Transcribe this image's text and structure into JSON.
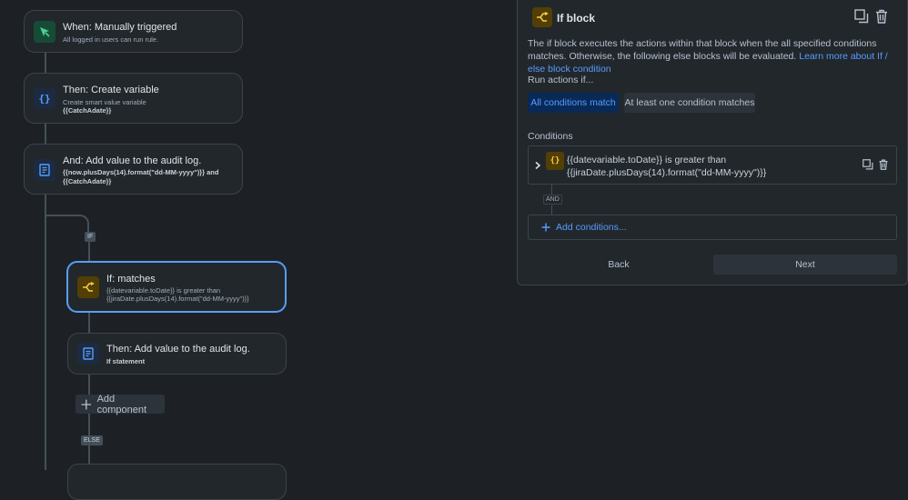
{
  "colors": {
    "background": "#1d2125",
    "card": "#22272b",
    "accent": "#579dff",
    "trigger_green": "#4bce97",
    "branch_yellow": "#f5cd47"
  },
  "flow": {
    "trigger": {
      "title": "When: Manually triggered",
      "subtitle": "All logged in users can run rule.",
      "icon": "cursor-click-icon"
    },
    "create_variable": {
      "title": "Then: Create variable",
      "subtitle": "Create smart value variable",
      "detail": "{{CatchAdate}}",
      "icon": "braces-icon"
    },
    "audit_log_1": {
      "title": "And: Add value to the audit log.",
      "detail_line1": "{{now.plusDays(14).format(\"dd-MM-yyyy\")}} and",
      "detail_line2": "{{CatchAdate}}",
      "icon": "document-icon"
    },
    "if_pill": "IF",
    "if_matches": {
      "title": "If: matches",
      "line1": "{{datevariable.toDate}} is greater than",
      "line2": "{{jiraDate.plusDays(14).format(\"dd-MM-yyyy\")}}",
      "icon": "branch-icon"
    },
    "audit_log_2": {
      "title": "Then: Add value to the audit log.",
      "detail": "If statement",
      "icon": "document-icon"
    },
    "add_component": "Add component",
    "else_pill": "ELSE"
  },
  "panel": {
    "title": "If block",
    "description": "The if block executes the actions within that block when the all specified conditions matches. Otherwise, the following else blocks will be evaluated. ",
    "link": "Learn more about If / else block condition",
    "run_actions_label": "Run actions if...",
    "options": [
      "All conditions match",
      "At least one condition matches"
    ],
    "selected_option": "All conditions match",
    "conditions_label": "Conditions",
    "condition_text": "{{datevariable.toDate}} is greater than {{jiraDate.plusDays(14).format(\"dd-MM-yyyy\")}}",
    "and_label": "AND",
    "add_conditions": "Add conditions...",
    "back": "Back",
    "next": "Next"
  }
}
